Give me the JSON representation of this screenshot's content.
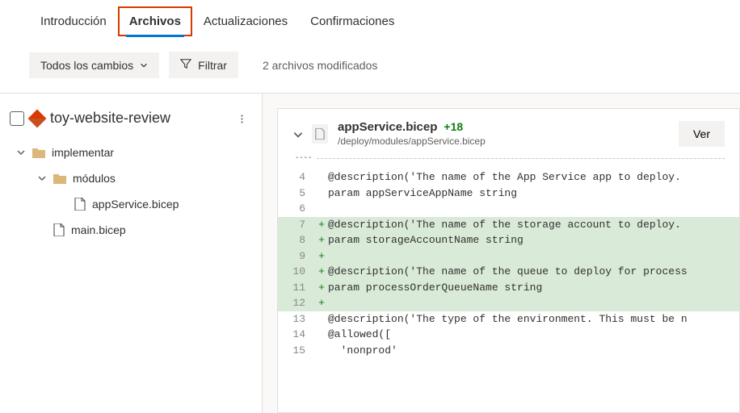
{
  "tabs": {
    "intro": "Introducción",
    "files": "Archivos",
    "updates": "Actualizaciones",
    "confirmations": "Confirmaciones"
  },
  "toolbar": {
    "all_changes": "Todos los cambios",
    "filter": "Filtrar",
    "summary": "2 archivos modificados"
  },
  "tree": {
    "root": "toy-website-review",
    "folder1": "implementar",
    "folder2": "módulos",
    "file1": "appService.bicep",
    "file2": "main.bicep"
  },
  "file": {
    "name": "appService.bicep",
    "additions": "+18",
    "path": "/deploy/modules/appService.bicep",
    "view_btn": "Ver"
  },
  "code": {
    "lines": [
      {
        "num": "4",
        "added": false,
        "text": "@description('The name of the App Service app to deploy."
      },
      {
        "num": "5",
        "added": false,
        "text": "param appServiceAppName string"
      },
      {
        "num": "6",
        "added": false,
        "text": ""
      },
      {
        "num": "7",
        "added": true,
        "text": "@description('The name of the storage account to deploy."
      },
      {
        "num": "8",
        "added": true,
        "text": "param storageAccountName string"
      },
      {
        "num": "9",
        "added": true,
        "text": ""
      },
      {
        "num": "10",
        "added": true,
        "text": "@description('The name of the queue to deploy for process"
      },
      {
        "num": "11",
        "added": true,
        "text": "param processOrderQueueName string"
      },
      {
        "num": "12",
        "added": true,
        "text": ""
      },
      {
        "num": "13",
        "added": false,
        "text": "@description('The type of the environment. This must be n"
      },
      {
        "num": "14",
        "added": false,
        "text": "@allowed(["
      },
      {
        "num": "15",
        "added": false,
        "text": "  'nonprod'"
      }
    ]
  }
}
